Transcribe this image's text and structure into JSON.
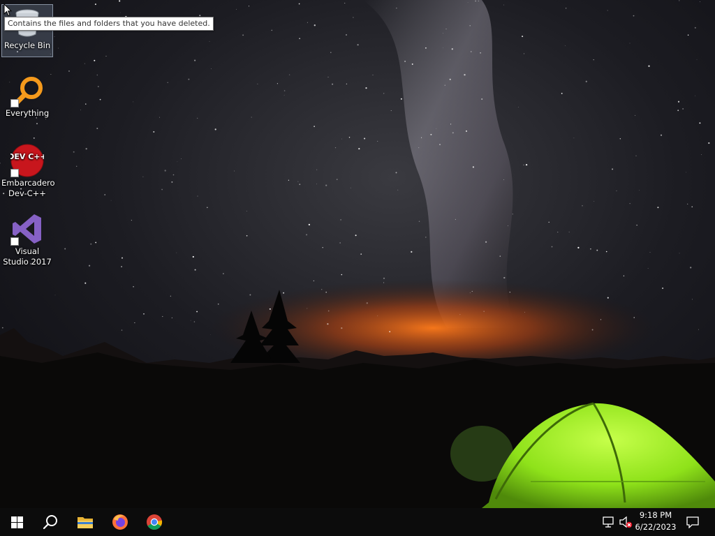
{
  "desktop": {
    "icons": [
      {
        "label": "Recycle Bin",
        "icon": "recycle-bin-icon"
      },
      {
        "label": "Everything",
        "icon": "everything-search-icon"
      },
      {
        "label": "Embarcadero Dev-C++",
        "icon": "devcpp-icon",
        "badge": "DEV C++"
      },
      {
        "label": "Visual Studio 2017",
        "icon": "visual-studio-icon"
      }
    ],
    "tooltip": "Contains the files and folders that you have deleted."
  },
  "taskbar": {
    "pinned": [
      {
        "name": "start",
        "icon": "windows-logo-icon"
      },
      {
        "name": "search",
        "icon": "search-icon"
      },
      {
        "name": "file-explorer",
        "icon": "folder-icon"
      },
      {
        "name": "firefox",
        "icon": "firefox-icon"
      },
      {
        "name": "chrome",
        "icon": "chrome-icon"
      }
    ],
    "tray": {
      "network_icon": "network-icon",
      "volume_icon": "volume-muted-icon",
      "time": "9:18 PM",
      "date": "6/22/2023",
      "notification_icon": "action-center-icon"
    }
  },
  "colors": {
    "taskbar": "#0c0c0c",
    "tent": "#8fe21a",
    "horizon_glow": "#ff6a10",
    "dev_red": "#c8161d",
    "vs_purple": "#8661c5"
  }
}
